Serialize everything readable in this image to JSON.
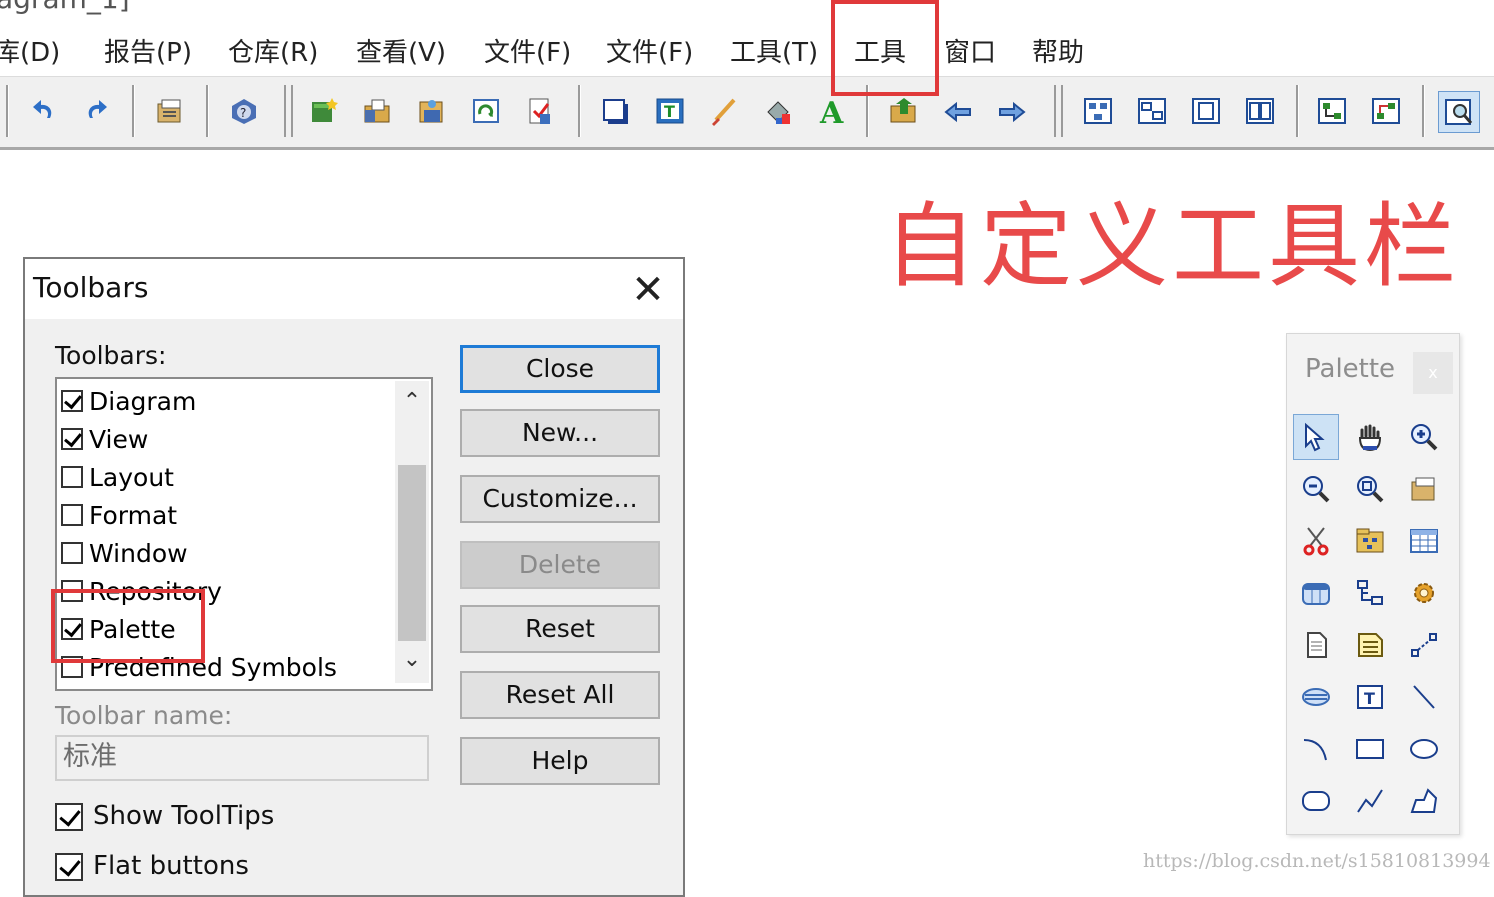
{
  "window": {
    "title_fragment": "agram_1]"
  },
  "menubar": {
    "items": [
      "库(D)",
      "报告(P)",
      "仓库(R)",
      "查看(V)",
      "文件(F)",
      "文件(F)",
      "工具(T)",
      "工具",
      "窗口",
      "帮助"
    ]
  },
  "toolbar": {
    "icons": [
      "undo-icon",
      "redo-icon",
      "properties-icon",
      "help-icon",
      "new-model-icon",
      "open-icon",
      "repository-icon",
      "refresh-icon",
      "check-icon",
      "shadow-icon",
      "text-icon",
      "brush-icon",
      "fill-icon",
      "font-icon",
      "import-icon",
      "back-icon",
      "forward-icon",
      "diagram1-icon",
      "diagram2-icon",
      "page-icon",
      "pages-icon",
      "layout1-icon",
      "layout2-icon",
      "preview-icon"
    ]
  },
  "annotation": {
    "caption": "自定义工具栏",
    "color": "#e84a4a"
  },
  "dialog": {
    "title": "Toolbars",
    "close_glyph": "✕",
    "toolbars_label": "Toolbars:",
    "items": [
      {
        "label": "Diagram",
        "checked": true
      },
      {
        "label": "View",
        "checked": true
      },
      {
        "label": "Layout",
        "checked": false
      },
      {
        "label": "Format",
        "checked": false
      },
      {
        "label": "Window",
        "checked": false
      },
      {
        "label": "Repository",
        "checked": false
      },
      {
        "label": "Palette",
        "checked": true
      },
      {
        "label": "Predefined Symbols",
        "checked": false
      }
    ],
    "buttons": {
      "close": "Close",
      "new": "New...",
      "customize": "Customize...",
      "delete": "Delete",
      "reset": "Reset",
      "reset_all": "Reset All",
      "help": "Help"
    },
    "toolbar_name_label": "Toolbar name:",
    "toolbar_name_value": "标准",
    "show_tooltips": {
      "label": "Show ToolTips",
      "checked": true
    },
    "flat_buttons": {
      "label": "Flat buttons",
      "checked": true
    }
  },
  "palette": {
    "title": "Palette",
    "close_glyph": "x",
    "tools": [
      "pointer-icon",
      "hand-icon",
      "zoom-in-icon",
      "zoom-out-icon",
      "zoom-fit-icon",
      "properties-icon",
      "cut-icon",
      "package-icon",
      "table-icon",
      "entity-icon",
      "hierarchy-icon",
      "settings-icon",
      "file-icon",
      "note-icon",
      "link-icon",
      "label-icon",
      "text-icon",
      "line-icon",
      "arc-icon",
      "rectangle-icon",
      "ellipse-icon",
      "rounded-rect-icon",
      "polyline-icon",
      "polygon-icon"
    ]
  },
  "watermark": "https://blog.csdn.net/s15810813994"
}
